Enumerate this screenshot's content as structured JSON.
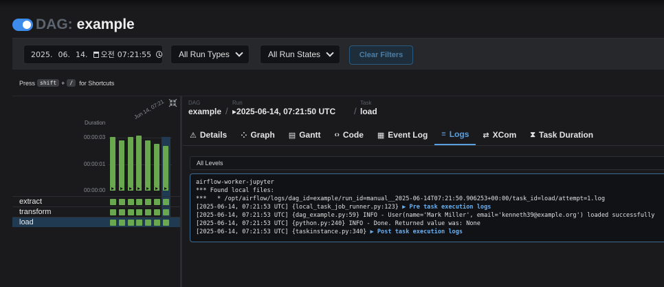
{
  "header": {
    "toggle_on": true,
    "prefix": "DAG:",
    "dag_name": "example"
  },
  "filters": {
    "date": {
      "year": "2025.",
      "month": "06.",
      "day": "14.",
      "ampm": "오전",
      "time": "07:21:55"
    },
    "run_types": "All Run Types",
    "run_states": "All Run States",
    "clear": "Clear Filters"
  },
  "shortcuts": {
    "press": "Press",
    "key1": "shift",
    "plus": "+",
    "key2": "/",
    "suffix": "for Shortcuts"
  },
  "grid": {
    "date_label": "Jun 14, 07:21",
    "duration_label": "Duration",
    "ticks": [
      "00:00:03",
      "00:00:01",
      "00:00:00"
    ],
    "runs": [
      {
        "duration_s": 2.9
      },
      {
        "duration_s": 2.7
      },
      {
        "duration_s": 2.9
      },
      {
        "duration_s": 3.0
      },
      {
        "duration_s": 2.7
      },
      {
        "duration_s": 2.5
      },
      {
        "duration_s": 2.4
      }
    ],
    "tasks": [
      {
        "name": "extract",
        "selected": false
      },
      {
        "name": "transform",
        "selected": false
      },
      {
        "name": "load",
        "selected": true
      }
    ],
    "success_color": "#6aa84f"
  },
  "breadcrumb": {
    "dag_label": "DAG",
    "dag_value": "example",
    "run_label": "Run",
    "run_value": "▸2025-06-14, 07:21:50 UTC",
    "task_label": "Task",
    "task_value": "load"
  },
  "tabs": [
    {
      "icon": "⚠",
      "label": "Details",
      "active": false
    },
    {
      "icon": "⁘",
      "label": "Graph",
      "active": false
    },
    {
      "icon": "▤",
      "label": "Gantt",
      "active": false
    },
    {
      "icon": "‹›",
      "label": "Code",
      "active": false
    },
    {
      "icon": "▦",
      "label": "Event Log",
      "active": false
    },
    {
      "icon": "≡",
      "label": "Logs",
      "active": true
    },
    {
      "icon": "⇄",
      "label": "XCom",
      "active": false
    },
    {
      "icon": "⧗",
      "label": "Task Duration",
      "active": false
    }
  ],
  "logs": {
    "level_filter": "All Levels",
    "lines": [
      {
        "text": "airflow-worker-jupyter"
      },
      {
        "text": "*** Found local files:"
      },
      {
        "text": "***   * /opt/airflow/logs/dag_id=example/run_id=manual__2025-06-14T07:21:50.906253+00:00/task_id=load/attempt=1.log"
      },
      {
        "text": "[2025-06-14, 07:21:53 UTC] {local_task_job_runner.py:123} ",
        "highlight": "▶ Pre task execution logs"
      },
      {
        "text": "[2025-06-14, 07:21:53 UTC] {dag_example.py:59} INFO - User(name='Mark Miller', email='kenneth39@example.org') loaded successfully"
      },
      {
        "text": "[2025-06-14, 07:21:53 UTC] {python.py:240} INFO - Done. Returned value was: None"
      },
      {
        "text": "[2025-06-14, 07:21:53 UTC] {taskinstance.py:340} ",
        "highlight": "▶ Post task execution logs"
      }
    ]
  }
}
